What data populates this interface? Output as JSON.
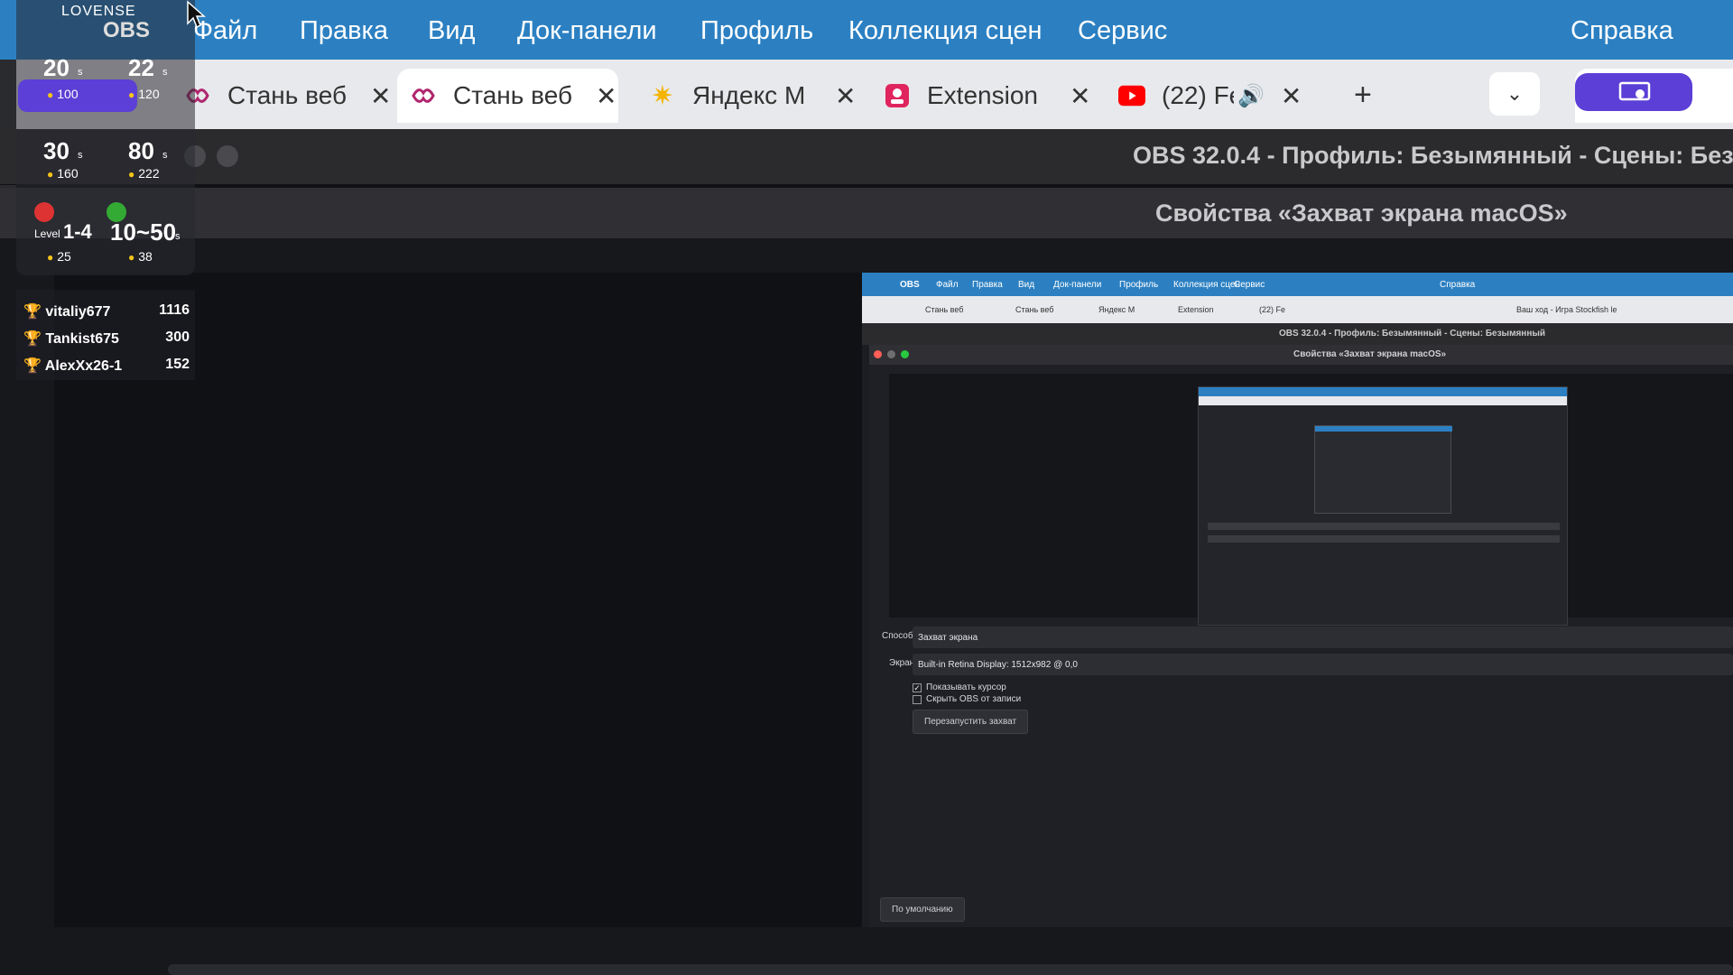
{
  "menubar": {
    "items": [
      "Файл",
      "Правка",
      "Вид",
      "Док-панели",
      "Профиль",
      "Коллекция сцен",
      "Сервис"
    ],
    "help": "Справка",
    "brand": "OBS"
  },
  "tabs": [
    {
      "title": "Стань веб",
      "icon": "lovense-icon",
      "active": false
    },
    {
      "title": "Стань веб",
      "icon": "lovense-icon",
      "active": true
    },
    {
      "title": "Яндекс М",
      "icon": "yandex-music-icon",
      "active": false
    },
    {
      "title": "Extension",
      "icon": "extension-icon",
      "active": false
    },
    {
      "title": "(22) Fe",
      "icon": "youtube-icon",
      "active": false
    }
  ],
  "obs": {
    "window_title": "OBS 32.0.4 - Профиль: Безымянный - Сцены: Без",
    "properties_title": "Свойства «Захват экрана macOS»"
  },
  "nested": {
    "menubar": [
      "OBS",
      "Файл",
      "Правка",
      "Вид",
      "Док-панели",
      "Профиль",
      "Коллекция сцен",
      "Сервис",
      "Справка"
    ],
    "tabs": [
      "Стань веб",
      "Стань веб",
      "Яндекс М",
      "Extension",
      "(22) Fe",
      "Ваш ход - Игра Stockfish le"
    ],
    "window_title": "OBS 32.0.4 - Профиль: Безымянный - Сцены: Безымянный",
    "properties_title": "Свойства «Захват экрана macOS»",
    "method_label": "Способ",
    "method_value": "Захват экрана",
    "screen_label": "Экран",
    "screen_value": "Built-in Retina Display: 1512x982 @ 0,0",
    "show_cursor": "Показывать курсор",
    "hide_obs": "Скрыть OBS от записи",
    "restart_button": "Перезапустить захват",
    "defaults_button": "По умолчанию"
  },
  "overlay": {
    "brand": "LOVENSE",
    "brand2": "OBS",
    "cells": [
      {
        "value": "20",
        "unit": "s",
        "coins": "100"
      },
      {
        "value": "22",
        "unit": "s",
        "coins": "120"
      },
      {
        "value": "30",
        "unit": "s",
        "coins": "160"
      },
      {
        "value": "80",
        "unit": "s",
        "coins": "222"
      }
    ],
    "level_label": "Level",
    "level_value": "1-4",
    "level_coins": "25",
    "timer_value": "10~50",
    "timer_unit": "s",
    "timer_coins": "38"
  },
  "leaderboard": [
    {
      "name": "vitaliy677",
      "score": "1116"
    },
    {
      "name": "Tankist675",
      "score": "300"
    },
    {
      "name": "AlexXx26-1",
      "score": "152"
    }
  ],
  "colors": {
    "menubar": "#2c80c2",
    "accent": "#5b3fd6",
    "tab_bg": "#e8e9ec",
    "obs_bg": "#1f2025"
  }
}
